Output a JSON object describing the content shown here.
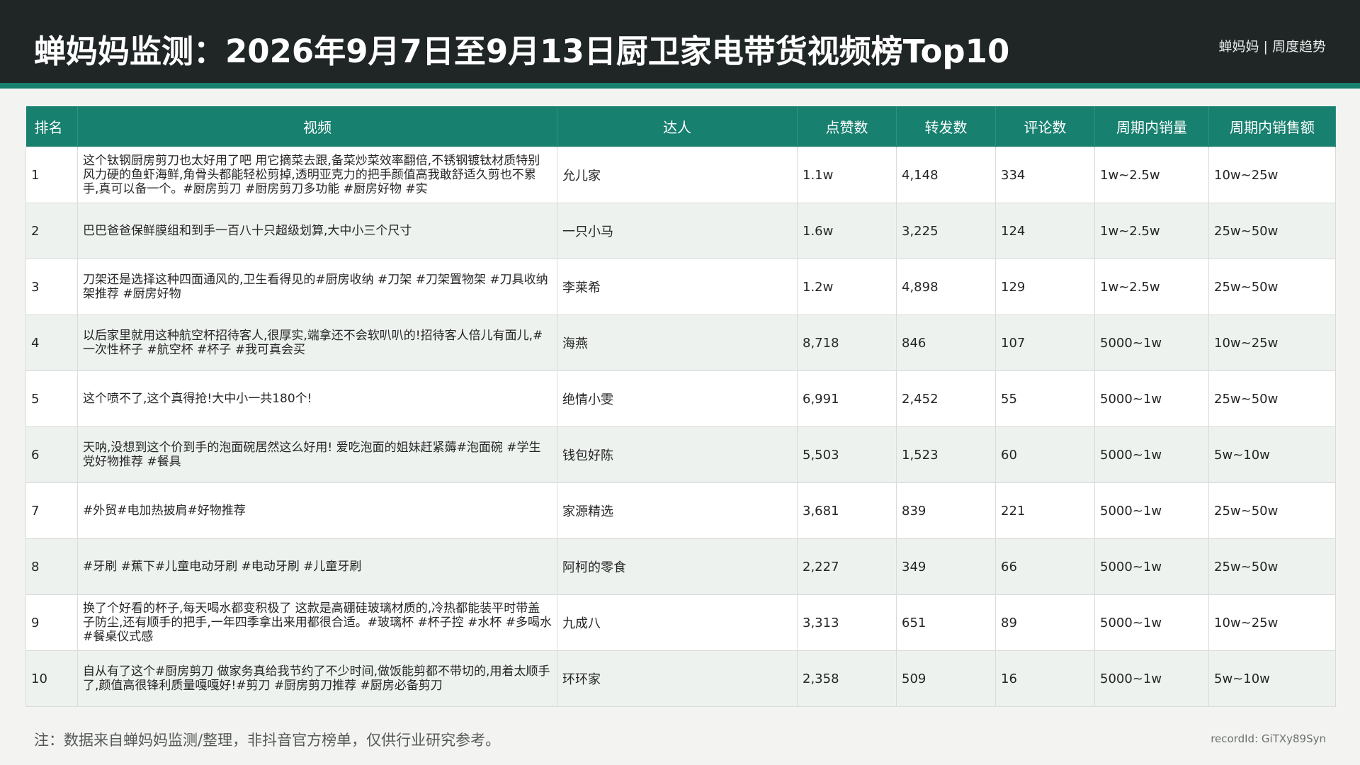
{
  "header": {
    "title": "蝉妈妈监测：2026年9月7日至9月13日厨卫家电带货视频榜Top10",
    "brand_tag": "蝉妈妈 | 周度趋势"
  },
  "table": {
    "columns": [
      "排名",
      "视频",
      "达人",
      "点赞数",
      "转发数",
      "评论数",
      "周期内销量",
      "周期内销售额"
    ],
    "rows": [
      {
        "rank": "1",
        "video": "这个钛钢厨房剪刀也太好用了吧 用它摘菜去跟,备菜炒菜效率翻倍,不锈钢镀钛材质特别风力硬的鱼虾海鲜,角骨头都能轻松剪掉,透明亚克力的把手颜值高我敢舒适久剪也不累手,真可以备一个。#厨房剪刀 #厨房剪刀多功能 #厨房好物 #实",
        "creator": "允儿家",
        "likes": "1.1w",
        "shares": "4,148",
        "comments": "334",
        "sales_volume": "1w~2.5w",
        "sales_amount": "10w~25w"
      },
      {
        "rank": "2",
        "video": "巴巴爸爸保鲜膜组和到手一百八十只超级划算,大中小三个尺寸",
        "creator": "一只小马",
        "likes": "1.6w",
        "shares": "3,225",
        "comments": "124",
        "sales_volume": "1w~2.5w",
        "sales_amount": "25w~50w"
      },
      {
        "rank": "3",
        "video": "刀架还是选择这种四面通风的,卫生看得见的#厨房收纳 #刀架 #刀架置物架 #刀具收纳架推荐 #厨房好物",
        "creator": "李莱希",
        "likes": "1.2w",
        "shares": "4,898",
        "comments": "129",
        "sales_volume": "1w~2.5w",
        "sales_amount": "25w~50w"
      },
      {
        "rank": "4",
        "video": "以后家里就用这种航空杯招待客人,很厚实,端拿还不会软叭叭的!招待客人倍儿有面儿,#一次性杯子 #航空杯 #杯子 #我可真会买",
        "creator": "海燕",
        "likes": "8,718",
        "shares": "846",
        "comments": "107",
        "sales_volume": "5000~1w",
        "sales_amount": "10w~25w"
      },
      {
        "rank": "5",
        "video": "这个喷不了,这个真得抢!大中小一共180个!",
        "creator": "绝情小雯",
        "likes": "6,991",
        "shares": "2,452",
        "comments": "55",
        "sales_volume": "5000~1w",
        "sales_amount": "25w~50w"
      },
      {
        "rank": "6",
        "video": "天呐,没想到这个价到手的泡面碗居然这么好用! 爱吃泡面的姐妹赶紧薅#泡面碗 #学生党好物推荐 #餐具",
        "creator": "钱包好陈",
        "likes": "5,503",
        "shares": "1,523",
        "comments": "60",
        "sales_volume": "5000~1w",
        "sales_amount": "5w~10w"
      },
      {
        "rank": "7",
        "video": "#外贸#电加热披肩#好物推荐",
        "creator": "家源精选",
        "likes": "3,681",
        "shares": "839",
        "comments": "221",
        "sales_volume": "5000~1w",
        "sales_amount": "25w~50w"
      },
      {
        "rank": "8",
        "video": "#牙刷 #蕉下#儿童电动牙刷 #电动牙刷 #儿童牙刷",
        "creator": "阿柯的零食",
        "likes": "2,227",
        "shares": "349",
        "comments": "66",
        "sales_volume": "5000~1w",
        "sales_amount": "25w~50w"
      },
      {
        "rank": "9",
        "video": "换了个好看的杯子,每天喝水都变积极了 这款是高硼硅玻璃材质的,冷热都能装平时带盖子防尘,还有顺手的把手,一年四季拿出来用都很合适。#玻璃杯 #杯子控 #水杯 #多喝水 #餐桌仪式感",
        "creator": "九成八",
        "likes": "3,313",
        "shares": "651",
        "comments": "89",
        "sales_volume": "5000~1w",
        "sales_amount": "10w~25w"
      },
      {
        "rank": "10",
        "video": "自从有了这个#厨房剪刀 做家务真给我节约了不少时间,做饭能剪都不带切的,用着太顺手了,颜值高很锋利质量嘎嘎好!#剪刀 #厨房剪刀推荐 #厨房必备剪刀",
        "creator": "环环家",
        "likes": "2,358",
        "shares": "509",
        "comments": "16",
        "sales_volume": "5000~1w",
        "sales_amount": "5w~10w"
      }
    ]
  },
  "footer": {
    "note": "注：数据来自蝉妈妈监测/整理，非抖音官方榜单，仅供行业研究参考。",
    "record_id": "recordId: GiTXy89Syn"
  },
  "colors": {
    "header_bg": "#1f2625",
    "accent": "#17806f",
    "row_alt": "#edf2ef"
  }
}
